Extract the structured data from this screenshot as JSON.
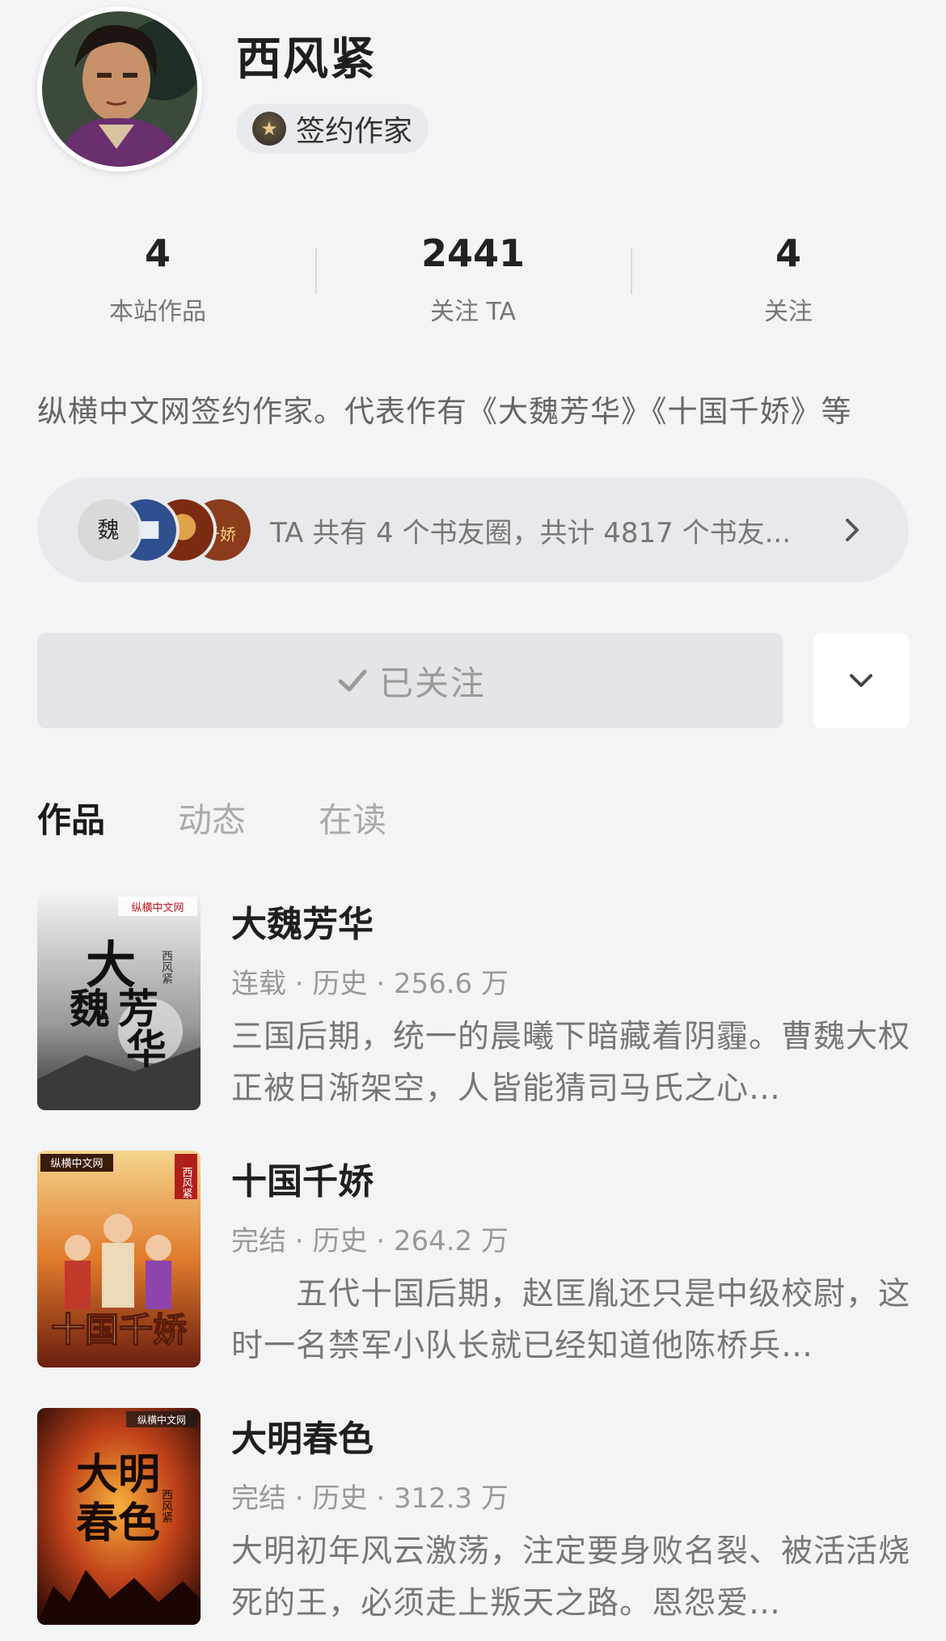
{
  "author": {
    "name": "西风紧",
    "badge": "签约作家",
    "bio": "纵横中文网签约作家。代表作有《大魏芳华》《十国千娇》等"
  },
  "stats": [
    {
      "value": "4",
      "label": "本站作品"
    },
    {
      "value": "2441",
      "label": "关注 TA"
    },
    {
      "value": "4",
      "label": "关注"
    }
  ],
  "book_circle": {
    "text": "TA 共有 4 个书友圈，共计 4817 个书友..."
  },
  "follow": {
    "label": "已关注"
  },
  "tabs": [
    {
      "label": "作品"
    },
    {
      "label": "动态"
    },
    {
      "label": "在读"
    }
  ],
  "books": [
    {
      "title": "大魏芳华",
      "meta": "连载 · 历史 · 256.6 万",
      "desc": "三国后期，统一的晨曦下暗藏着阴霾。曹魏大权正被日渐架空，人皆能猜司马氏之心…",
      "cover_text": "大魏芳华",
      "cover_publisher": "纵横中文网",
      "cover_author": "西风紧"
    },
    {
      "title": "十国千娇",
      "meta": "完结 · 历史 · 264.2 万",
      "desc": "　　五代十国后期，赵匡胤还只是中级校尉，这时一名禁军小队长就已经知道他陈桥兵…",
      "cover_text": "十国千娇",
      "cover_publisher": "纵横中文网",
      "cover_author": "西风紧"
    },
    {
      "title": "大明春色",
      "meta": "完结 · 历史 · 312.3 万",
      "desc": "大明初年风云激荡，注定要身败名裂、被活活烧死的王，必须走上叛天之路。恩怨爱…",
      "cover_text": "大明春色",
      "cover_publisher": "纵横中文网",
      "cover_author": "西风紧"
    }
  ],
  "colors": {
    "accent": "#e94b55",
    "background": "#f3f4f6"
  }
}
